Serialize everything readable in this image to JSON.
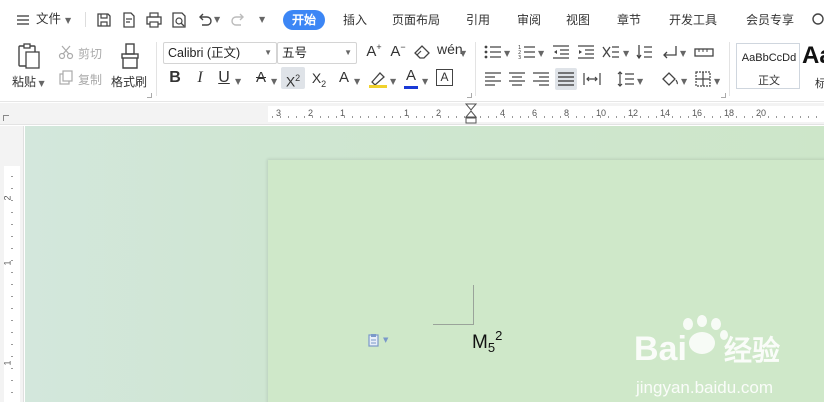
{
  "menu": {
    "file_label": "文件",
    "tabs": [
      "开始",
      "插入",
      "页面布局",
      "引用",
      "审阅",
      "视图",
      "章节",
      "开发工具",
      "会员专享"
    ],
    "active_tab": "开始"
  },
  "ribbon": {
    "paste_label": "粘贴",
    "cut_label": "剪切",
    "copy_label": "复制",
    "format_painter_label": "格式刷",
    "font_name": "Calibri (正文)",
    "font_size": "五号",
    "style_preview": "AaBbCcDd",
    "style_name": "正文",
    "style_next_preview": "Aa",
    "style_next_name": "标"
  },
  "document": {
    "base": "M",
    "subscript": "5",
    "superscript": "2"
  },
  "ruler": {
    "h_ticks": [
      "3",
      "2",
      "1",
      "1",
      "2",
      "4",
      "6",
      "8",
      "10",
      "12",
      "14",
      "16",
      "18",
      "20"
    ],
    "v_ticks": [
      "2",
      "1",
      "1"
    ]
  },
  "watermark": {
    "brand": "Baidu经验",
    "url": "jingyan.baidu.com"
  },
  "colors": {
    "accent": "#3c86f5",
    "font_color": "#1a3ad6",
    "page_bg": "#cfe8c9"
  }
}
